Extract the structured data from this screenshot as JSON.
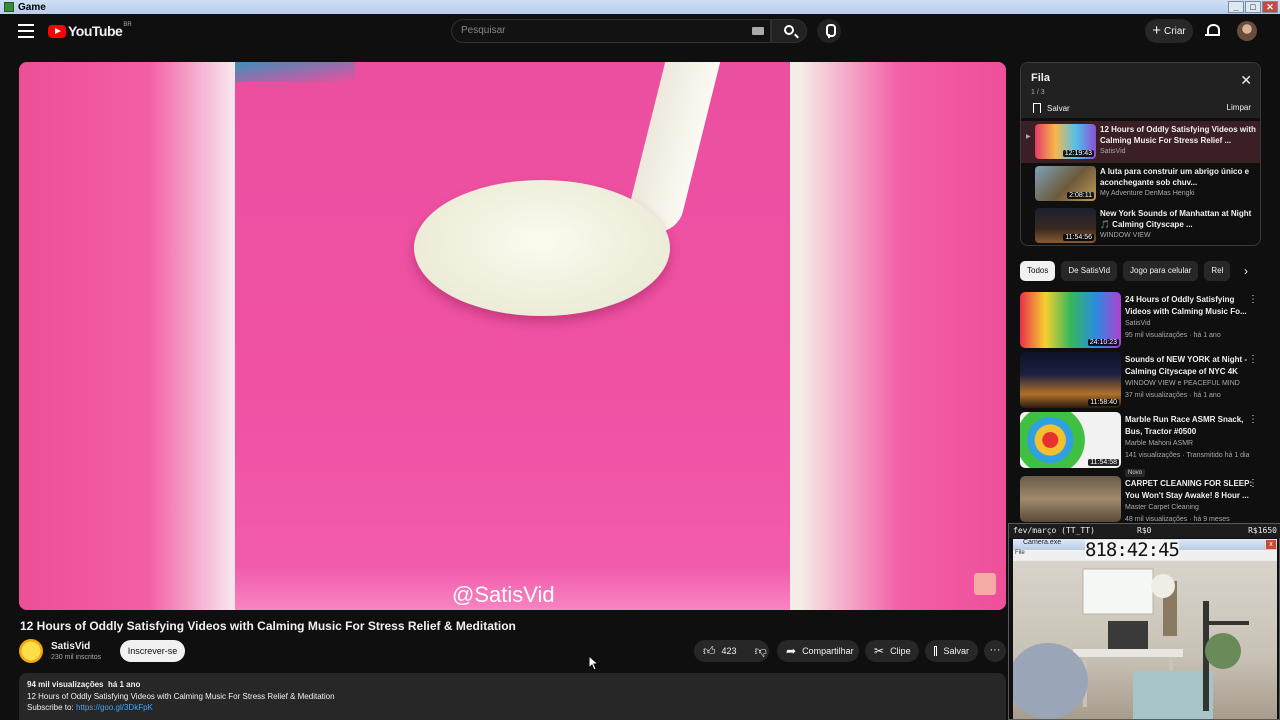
{
  "window": {
    "title": "Game",
    "buttons": [
      "_",
      "□",
      "✕"
    ]
  },
  "header": {
    "logo_text": "YouTube",
    "logo_region": "BR",
    "search_placeholder": "Pesquisar",
    "create_label": "Criar",
    "icons": [
      "menu-icon",
      "keyboard-icon",
      "search-icon",
      "mic-icon",
      "bell-icon",
      "avatar"
    ]
  },
  "player": {
    "watermark": "@SatisVid"
  },
  "video": {
    "title": "12 Hours of Oddly Satisfying Videos with Calming Music For Stress Relief & Meditation",
    "channel": "SatisVid",
    "subscribers": "230 mil inscritos",
    "subscribe_label": "Inscrever-se",
    "likes": "423",
    "share_label": "Compartilhar",
    "clip_label": "Clipe",
    "save_label": "Salvar",
    "more": "···",
    "description": {
      "views": "94 mil visualizações",
      "age": "há 1 ano",
      "line1": "12 Hours of Oddly Satisfying Videos with Calming Music For Stress Relief & Meditation",
      "subscribe_prefix": "Subscribe to:",
      "link": "https://goo.gl/3DkFpK"
    }
  },
  "queue": {
    "title": "Fila",
    "count": "1 / 3",
    "save_label": "Salvar",
    "clear_label": "Limpar",
    "close": "✕",
    "items": [
      {
        "title": "12 Hours of Oddly Satisfying Videos with Calming Music For Stress Relief ...",
        "channel": "SatisVid",
        "duration": "12:19:43",
        "marker": "▶"
      },
      {
        "title": "A luta para construir um abrigo único e aconchegante sob chuv...",
        "channel": "My Adventure DenMas Hengki",
        "duration": "2:08:11",
        "marker": ""
      },
      {
        "title": "New York Sounds of Manhattan at Night 🎵 Calming Cityscape ...",
        "channel": "WINDOW VIEW",
        "duration": "11:54:56",
        "marker": ""
      }
    ]
  },
  "chips": [
    "Todos",
    "De SatisVid",
    "Jogo para celular",
    "Rel"
  ],
  "recommendations": [
    {
      "title": "24 Hours of Oddly Satisfying Videos with Calming Music Fo...",
      "channel": "SatisVid",
      "stats": "95 mil visualizações · há 1 ano",
      "duration": "24:10:23",
      "badge": ""
    },
    {
      "title": "Sounds of NEW YORK at Night - Calming Cityscape of NYC 4K",
      "channel": "WINDOW VIEW e PEACEFUL MIND",
      "stats": "37 mil visualizações · há 1 ano",
      "duration": "11:58:40",
      "badge": ""
    },
    {
      "title": "Marble Run Race ASMR Snack, Bus, Tractor #0500",
      "channel": "Marble Mahoni ASMR",
      "stats": "141 visualizações · Transmitido há 1 dia",
      "duration": "11:54:58",
      "badge": "Novo"
    },
    {
      "title": "CARPET CLEANING FOR SLEEP: You Won't Stay Awake! 8 Hour ...",
      "channel": "Master Carpet Cleaning",
      "stats": "48 mil visualizações · há 9 meses",
      "duration": "",
      "badge": ""
    }
  ],
  "overlay": {
    "left": "fev/março (TT_TT)",
    "mid": "R$0",
    "right": "R$1650",
    "cam_title": "Camera.exe",
    "cam_menu": "File",
    "clock": "818:42:45",
    "close": "x"
  },
  "colors": {
    "accent": "#ff0000",
    "link": "#3ea6ff",
    "background": "#0f0f0f"
  }
}
